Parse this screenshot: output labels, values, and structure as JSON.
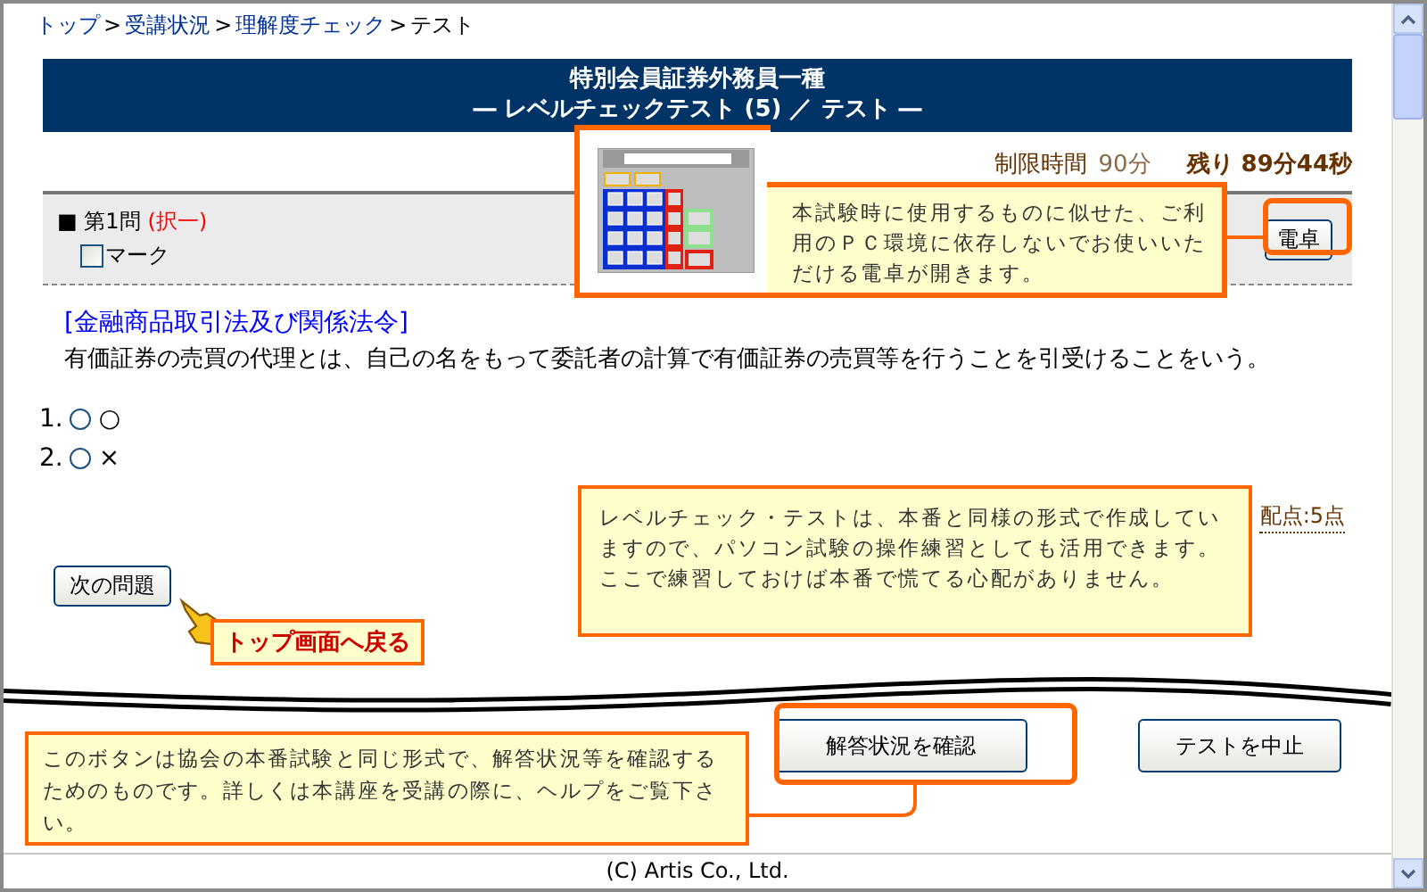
{
  "breadcrumb_separator": ">",
  "breadcrumb": [
    {
      "label": "トップ",
      "link": true
    },
    {
      "label": "受講状況",
      "link": true
    },
    {
      "label": "理解度チェック",
      "link": true
    },
    {
      "label": "テスト",
      "link": false
    }
  ],
  "title": {
    "line1": "特別会員証券外務員一種",
    "line2": "― レベルチェックテスト (5) ／ テスト ―"
  },
  "timer": {
    "limit_label": "制限時間",
    "limit_value": "90分",
    "remaining": "残り 89分44秒"
  },
  "question": {
    "number": "■ 第1問",
    "type": "(択一)",
    "mark": {
      "label": "マーク",
      "checked": false
    },
    "calculator_button": "電卓",
    "category": "[金融商品取引法及び関係法令]",
    "text": "有価証券の売買の代理とは、自己の名をもって委託者の計算で有価証券の売買等を行うことを引受けることをいう。",
    "options": [
      {
        "number": "1.",
        "label": "○",
        "selected": false
      },
      {
        "number": "2.",
        "label": "×",
        "selected": false
      }
    ],
    "points": "配点:5点"
  },
  "next_button": "次の問題",
  "buttons": [
    "解答状況を確認",
    "テストを中止"
  ],
  "footer": "(C) Artis Co., Ltd.",
  "callouts": [
    {
      "kind": "calculator",
      "text": "本試験時に使用するものに似せた、ご利用のＰＣ環境に依存しないでお使いいただける電卓が開きます。"
    },
    {
      "kind": "note",
      "text": "レベルチェック・テストは、本番と同様の形式で作成していますので、パソコン試験の操作練習としても活用できます。ここで練習しておけば本番で慌てる心配がありません。"
    },
    {
      "kind": "pointer",
      "text": "トップ画面へ戻る"
    },
    {
      "kind": "help",
      "text": "このボタンは協会の本番試験と同じ形式で、解答状況等を確認するためのものです。詳しくは本講座を受講の際に、ヘルプをご覧下さい。"
    }
  ]
}
